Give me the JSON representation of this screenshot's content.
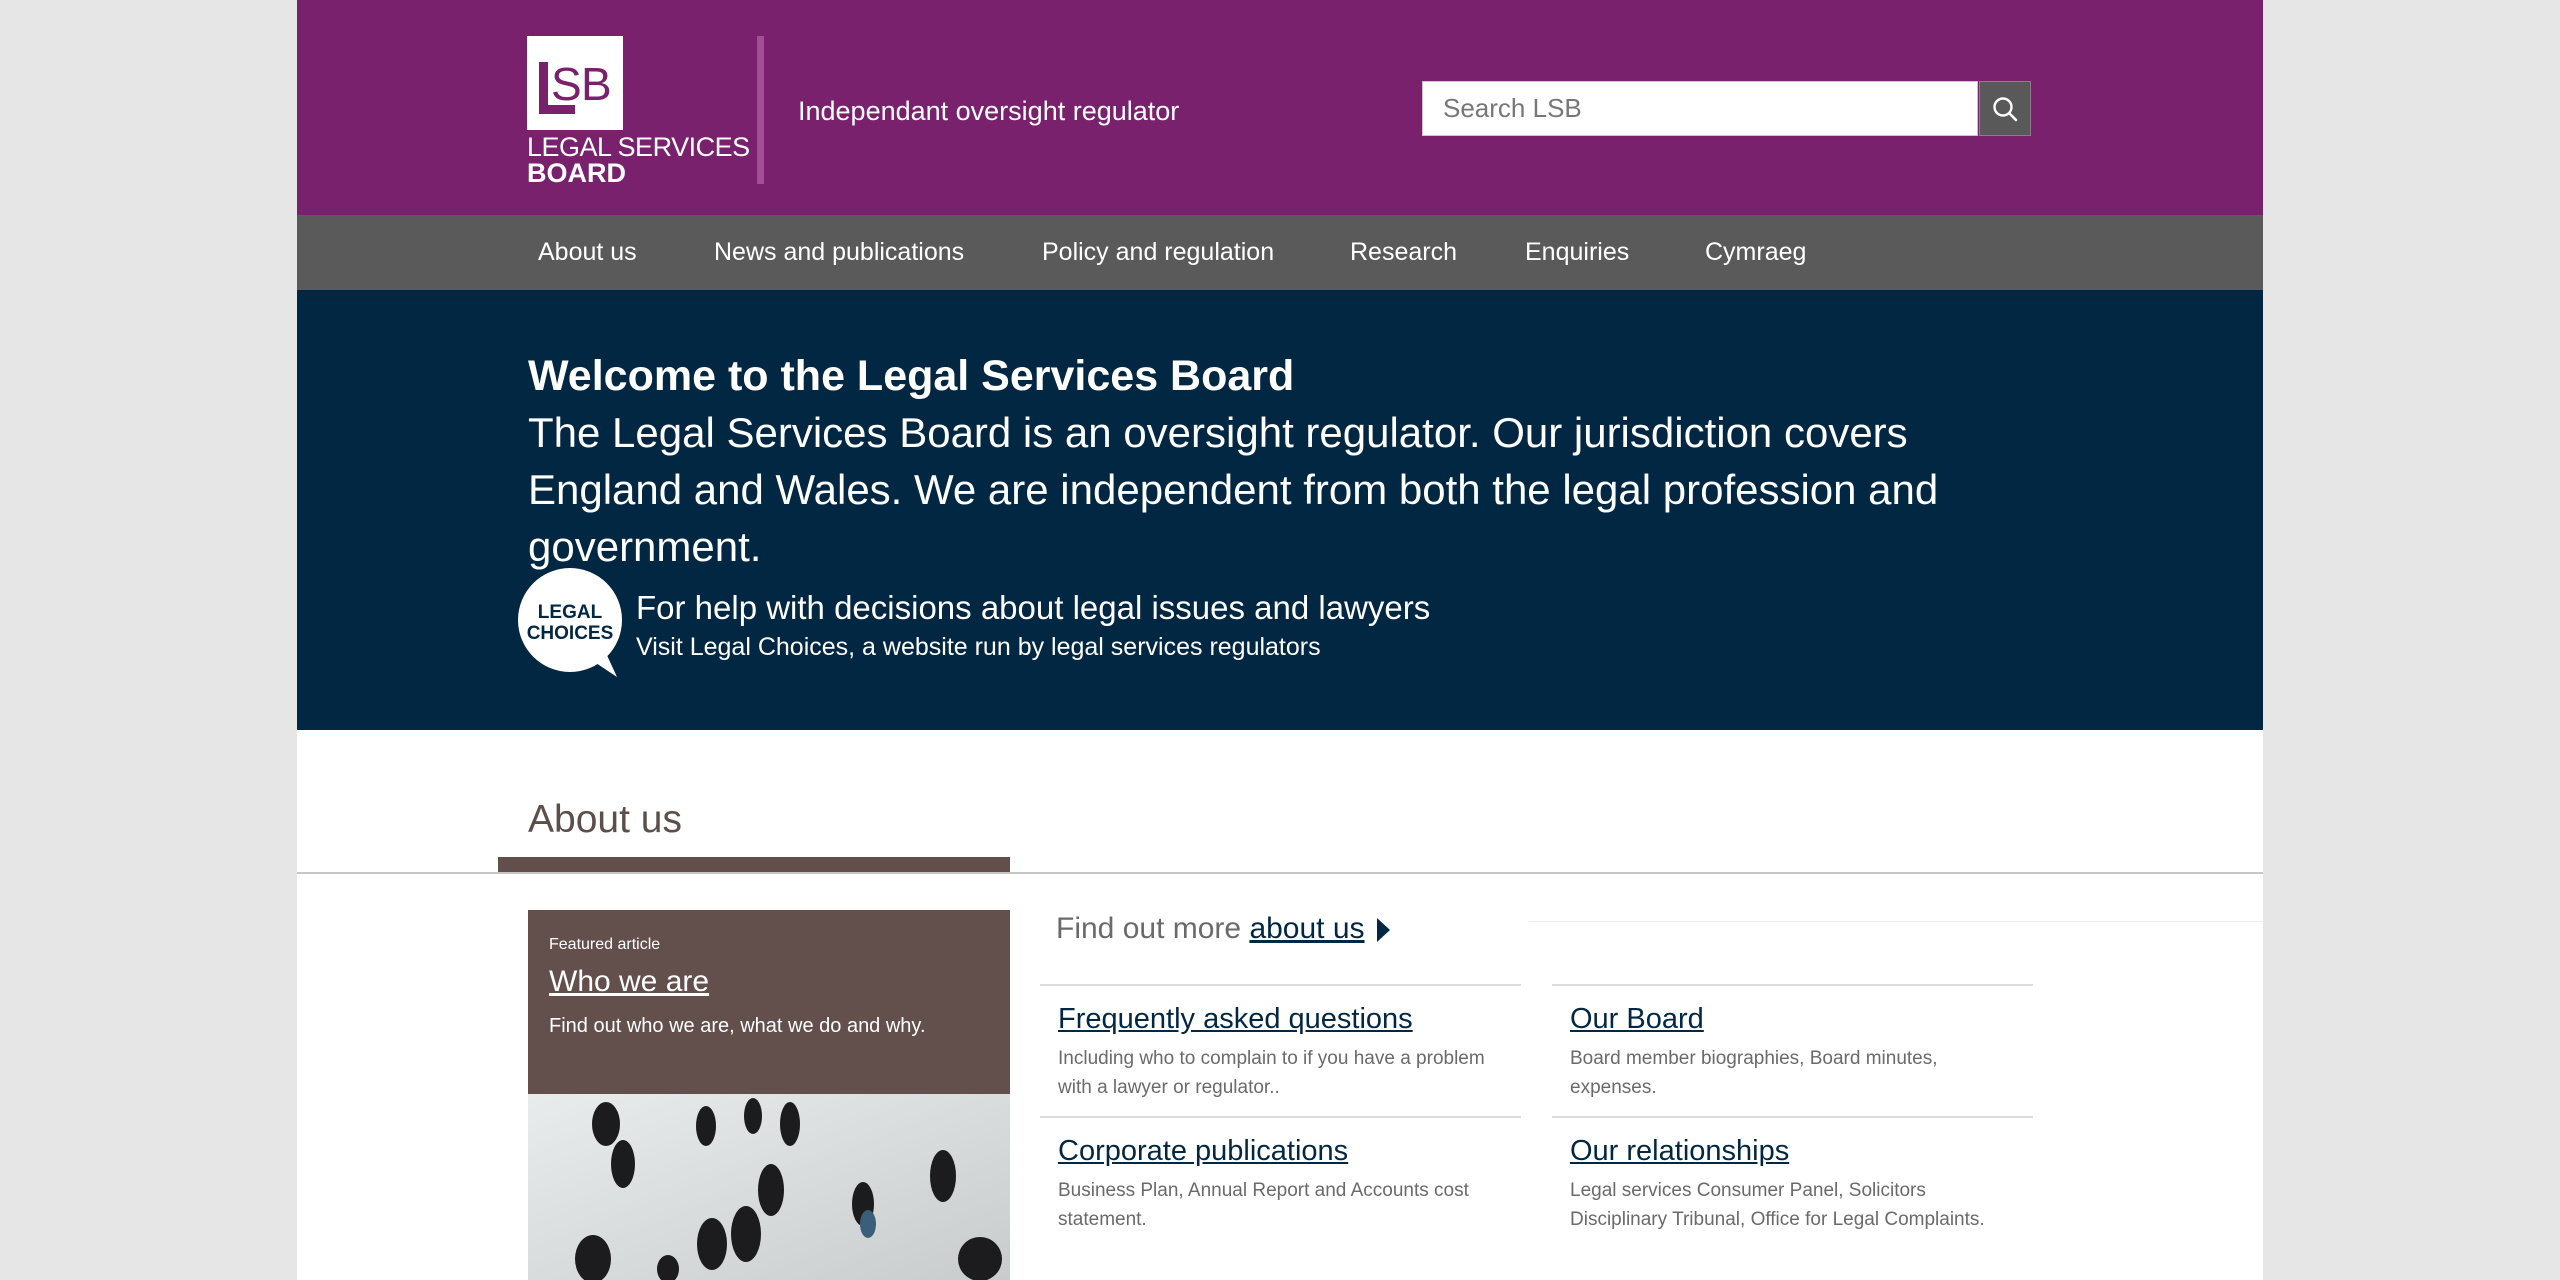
{
  "header": {
    "logo_mark": "LSB",
    "logo_line1": "LEGAL SERVICES",
    "logo_line2": "BOARD",
    "tagline": "Independant oversight regulator",
    "search_placeholder": "Search LSB",
    "search_icon": "search-icon",
    "brand_color": "#7a216e"
  },
  "nav": {
    "items": [
      {
        "label": "About us"
      },
      {
        "label": "News and publications"
      },
      {
        "label": "Policy and regulation"
      },
      {
        "label": "Research"
      },
      {
        "label": "Enquiries"
      },
      {
        "label": "Cymraeg"
      }
    ]
  },
  "hero": {
    "title": "Welcome to the Legal Services Board",
    "text": "The Legal Services Board is an oversight regulator. Our jurisdiction covers England and Wales. We are independent from both the legal profession and government.",
    "legal_choices": {
      "logo_line1": "LEGAL",
      "logo_line2": "CHOICES",
      "heading": "For help with decisions about legal issues and lawyers",
      "subtext": "Visit Legal Choices, a website run by legal services regulators"
    },
    "background_color": "#022742"
  },
  "about": {
    "section_title": "About us",
    "featured": {
      "kicker": "Featured article",
      "title": "Who we are",
      "description": "Find out who we are, what we do and why."
    },
    "find_more": {
      "prefix": "Find out more",
      "link": "about us"
    },
    "links": [
      {
        "title": "Frequently asked questions",
        "description": "Including who to complain to if you have a problem with a lawyer or regulator.."
      },
      {
        "title": "Our Board",
        "description": "Board member biographies, Board minutes, expenses."
      },
      {
        "title": "Corporate publications",
        "description": "Business Plan, Annual Report and Accounts cost statement."
      },
      {
        "title": "Our relationships",
        "description": "Legal services Consumer Panel, Solicitors Disciplinary Tribunal, Office for Legal Complaints."
      }
    ]
  }
}
